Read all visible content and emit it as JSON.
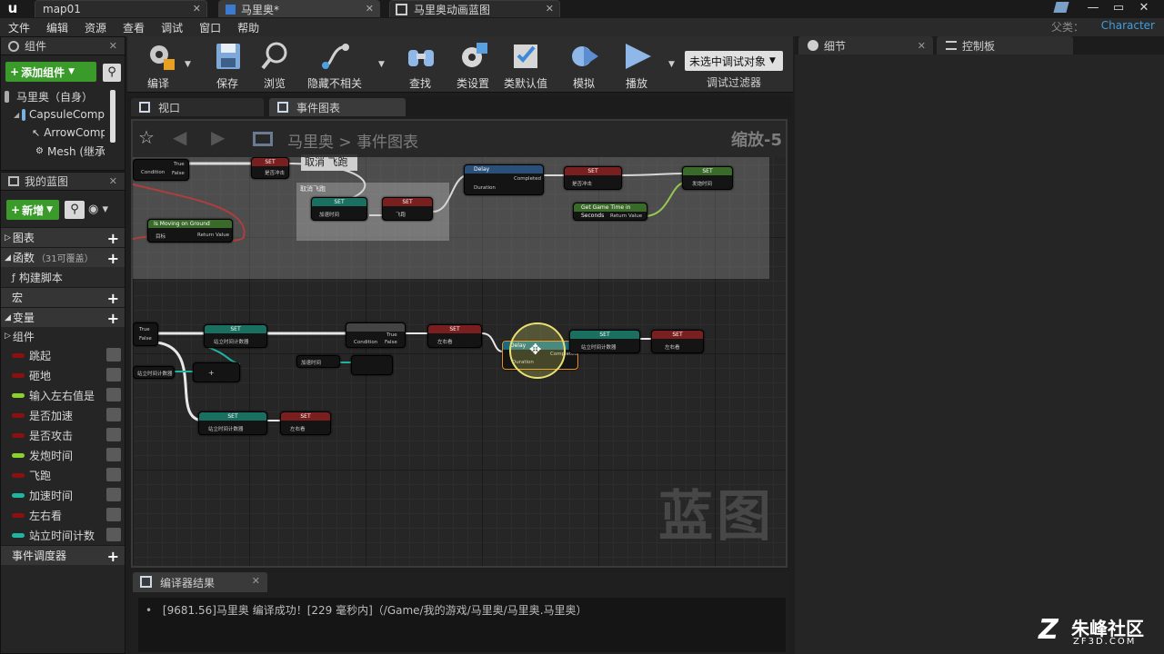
{
  "titlebar": {
    "tabs": [
      {
        "label": "map01"
      },
      {
        "label": "马里奥*"
      },
      {
        "label": "马里奥动画蓝图"
      }
    ]
  },
  "menubar": {
    "items": [
      "文件",
      "编辑",
      "资源",
      "查看",
      "调试",
      "窗口",
      "帮助"
    ],
    "parent_label": "父类：",
    "parent_class": "Character"
  },
  "components": {
    "tab_label": "组件",
    "add_label": "添加组件",
    "items": [
      {
        "label": "马里奥（自身）"
      },
      {
        "label": "CapsuleComp"
      },
      {
        "label": "ArrowComp"
      },
      {
        "label": "Mesh (继承)"
      }
    ]
  },
  "my_blueprint": {
    "tab_label": "我的蓝图",
    "new_label": "新增",
    "sections": {
      "graphs": "图表",
      "functions": "函数",
      "functions_count": "（31可覆盖）",
      "construction_script": "构建脚本",
      "macros": "宏",
      "variables": "变量",
      "components": "组件",
      "event_dispatchers": "事件调度器"
    },
    "variables": [
      {
        "label": "跳起",
        "color": "#8c1010"
      },
      {
        "label": "砸地",
        "color": "#8c1010"
      },
      {
        "label": "输入左右值是",
        "color": "#8bd12c"
      },
      {
        "label": "是否加速",
        "color": "#8c1010"
      },
      {
        "label": "是否攻击",
        "color": "#8c1010"
      },
      {
        "label": "发炮时间",
        "color": "#8bd12c"
      },
      {
        "label": "飞跑",
        "color": "#8c1010"
      },
      {
        "label": "加速时间",
        "color": "#1fb5a0"
      },
      {
        "label": "左右看",
        "color": "#8c1010"
      },
      {
        "label": "站立时间计数",
        "color": "#1fb5a0"
      }
    ]
  },
  "toolbar": {
    "buttons": [
      {
        "label": "编译",
        "icon": "compile-gear-icon"
      },
      {
        "label": "保存",
        "icon": "save-disk-icon"
      },
      {
        "label": "浏览",
        "icon": "browse-magnifier-icon"
      },
      {
        "label": "隐藏不相关",
        "icon": "hide-unrelated-icon"
      },
      {
        "label": "查找",
        "icon": "binoculars-icon"
      },
      {
        "label": "类设置",
        "icon": "class-settings-gear-icon"
      },
      {
        "label": "类默认值",
        "icon": "class-defaults-checklist-icon"
      },
      {
        "label": "模拟",
        "icon": "simulate-icon"
      },
      {
        "label": "播放",
        "icon": "play-icon"
      }
    ],
    "debug_select": "未选中调试对象",
    "debug_filter": "调试过滤器"
  },
  "editor_tabs": [
    {
      "label": "视口"
    },
    {
      "label": "事件图表"
    }
  ],
  "graph": {
    "breadcrumb_root": "马里奥",
    "breadcrumb_sep": ">",
    "breadcrumb_leaf": "事件图表",
    "zoom": "缩放-5",
    "watermark": "蓝图",
    "comment_cancel": "取消 飞跑",
    "comment_dash": "取消飞跑",
    "nodes": {
      "set": "SET",
      "delay": "Delay",
      "duration": "Duration",
      "completed": "Completed",
      "condition": "Condition",
      "true": "True",
      "false": "False",
      "is_moving_on_ground": "Is Moving on Ground",
      "get_game_time": "Get Game Time in Seconds",
      "return_value": "Return Value",
      "target": "目标",
      "is_fly": "是否冲击",
      "accel_time": "加速时间",
      "fly": "飞跑",
      "fire_time": "发炮时间",
      "stand_count": "站立时间计数器",
      "left_right": "左右看"
    }
  },
  "details": {
    "tabs": [
      {
        "label": "细节"
      },
      {
        "label": "控制板"
      }
    ]
  },
  "compiler": {
    "tab_label": "编译器结果",
    "message": "[9681.56]马里奥 编译成功！[229 毫秒内]（/Game/我的游戏/马里奥/马里奥.马里奥）"
  },
  "logo": {
    "text": "朱峰社区",
    "sub": "ZF3D.COM"
  }
}
